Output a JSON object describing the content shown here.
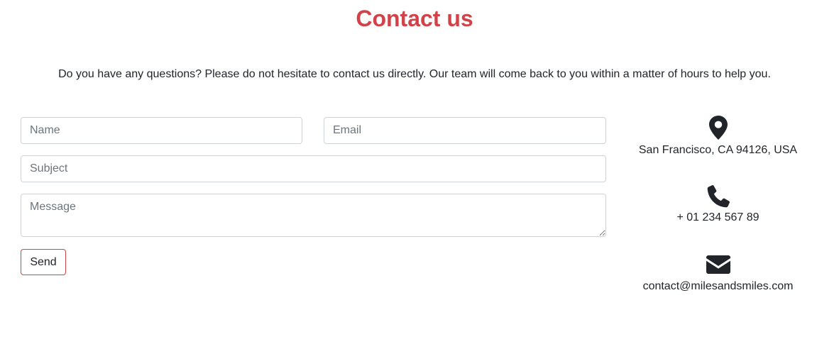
{
  "page": {
    "title": "Contact us",
    "intro": "Do you have any questions? Please do not hesitate to contact us directly. Our team will come back to you within a matter of hours to help you."
  },
  "form": {
    "name_placeholder": "Name",
    "email_placeholder": "Email",
    "subject_placeholder": "Subject",
    "message_placeholder": "Message",
    "send_label": "Send"
  },
  "contact_info": {
    "address": "San Francisco, CA 94126, USA",
    "address_icon": "map-marker-icon",
    "phone": "+ 01 234 567 89",
    "phone_icon": "phone-icon",
    "email": "contact@milesandsmiles.com",
    "email_icon": "envelope-icon"
  },
  "colors": {
    "accent": "#d14349",
    "text": "#212529",
    "border": "#ced4da",
    "placeholder": "#6c757d"
  }
}
